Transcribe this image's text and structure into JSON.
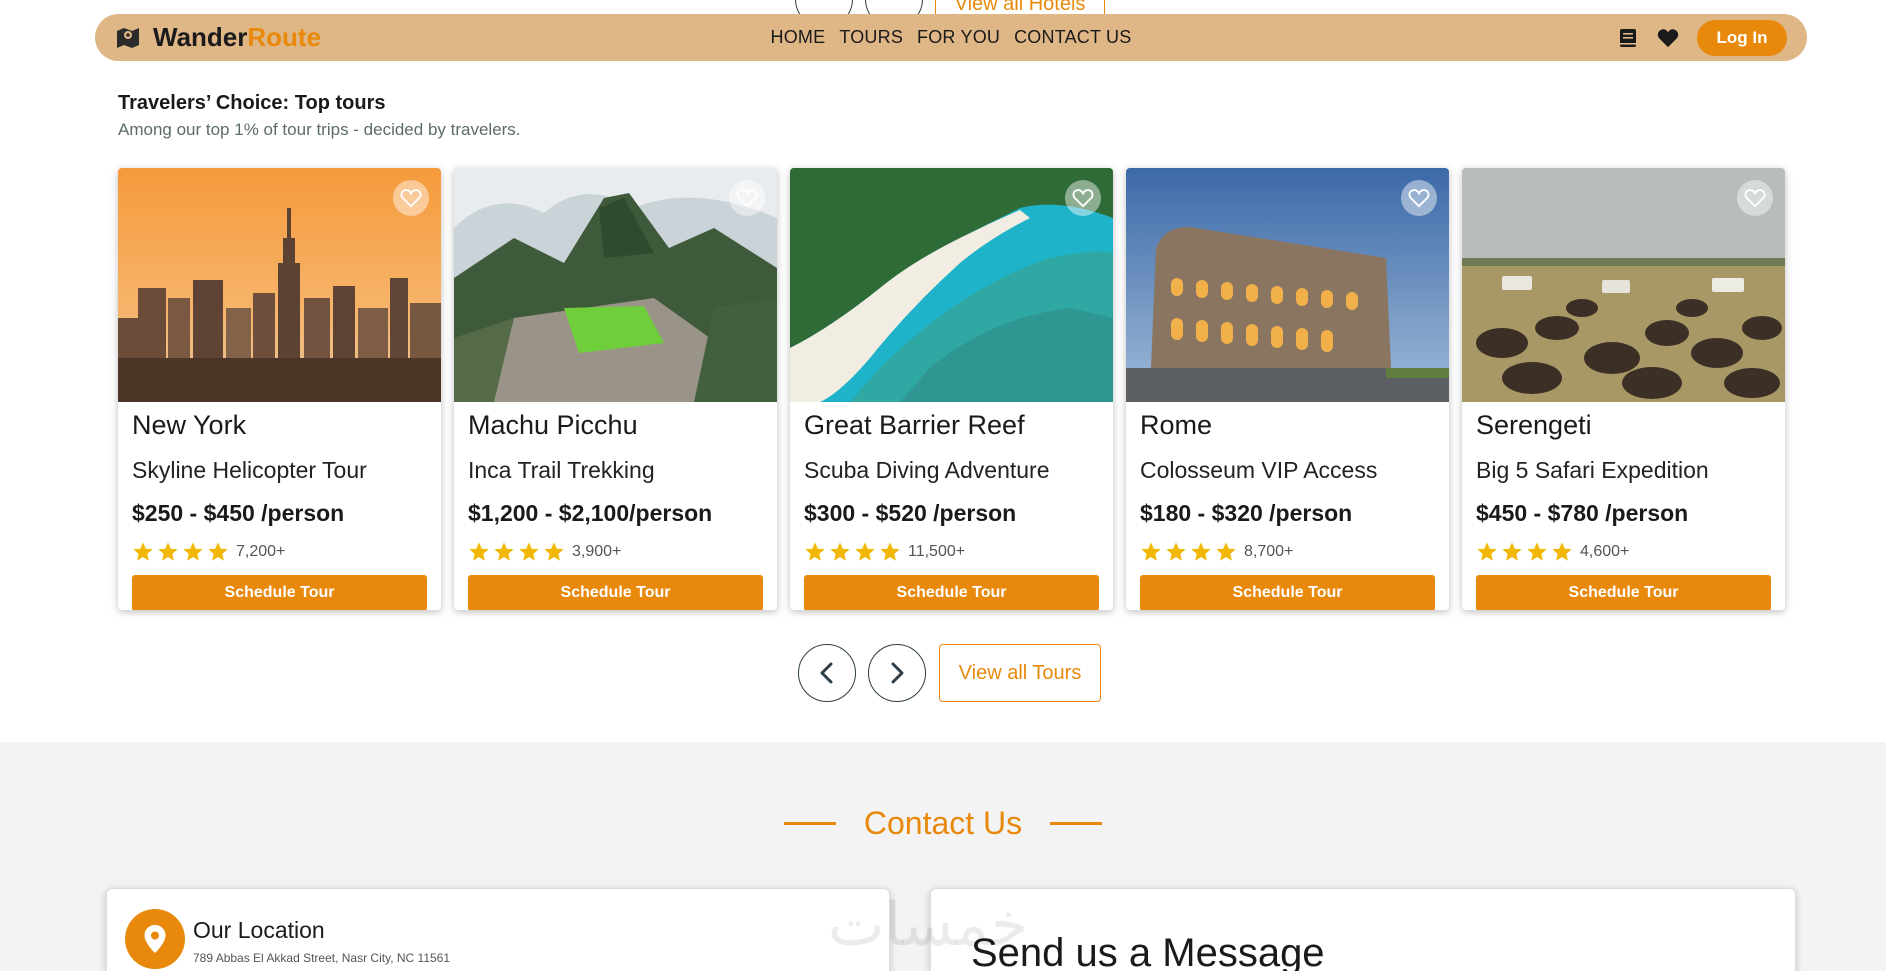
{
  "header": {
    "brand_part1": "Wander",
    "brand_part2": "Route",
    "nav": [
      "HOME",
      "TOURS",
      "FOR YOU",
      "CONTACT US"
    ],
    "login_label": "Log In",
    "icons": [
      "book-icon",
      "heart-icon"
    ]
  },
  "peek": {
    "view_all_label": "View all Hotels"
  },
  "section": {
    "title": "Travelers’ Choice: Top tours",
    "subtitle": "Among our top 1% of tour trips - decided by travelers."
  },
  "cards": [
    {
      "place": "New York",
      "tour": "Skyline Helicopter Tour",
      "price": "$250 - $450 /person",
      "rating": 4,
      "count": "7,200+",
      "button": "Schedule Tour"
    },
    {
      "place": "Machu Picchu",
      "tour": "Inca Trail Trekking",
      "price": "$1,200 - $2,100/person",
      "rating": 4,
      "count": "3,900+",
      "button": "Schedule Tour"
    },
    {
      "place": "Great Barrier Reef",
      "tour": "Scuba Diving Adventure",
      "price": "$300 - $520 /person",
      "rating": 4,
      "count": "11,500+",
      "button": "Schedule Tour"
    },
    {
      "place": "Rome",
      "tour": "Colosseum VIP Access",
      "price": "$180 - $320 /person",
      "rating": 4,
      "count": "8,700+",
      "button": "Schedule Tour"
    },
    {
      "place": "Serengeti",
      "tour": "Big 5 Safari Expedition",
      "price": "$450 - $780 /person",
      "rating": 4,
      "count": "4,600+",
      "button": "Schedule Tour"
    }
  ],
  "pager": {
    "view_all_label": "View all Tours"
  },
  "contact": {
    "title": "Contact Us",
    "location_title": "Our Location",
    "location_address": "789 Abbas El Akkad Street, Nasr City, NC 11561",
    "message_title": "Send us a Message"
  },
  "watermark": "خمسات",
  "colors": {
    "accent": "#e8890c",
    "header_bg": "#dfb685",
    "contact_bg": "#f3f3f3"
  }
}
